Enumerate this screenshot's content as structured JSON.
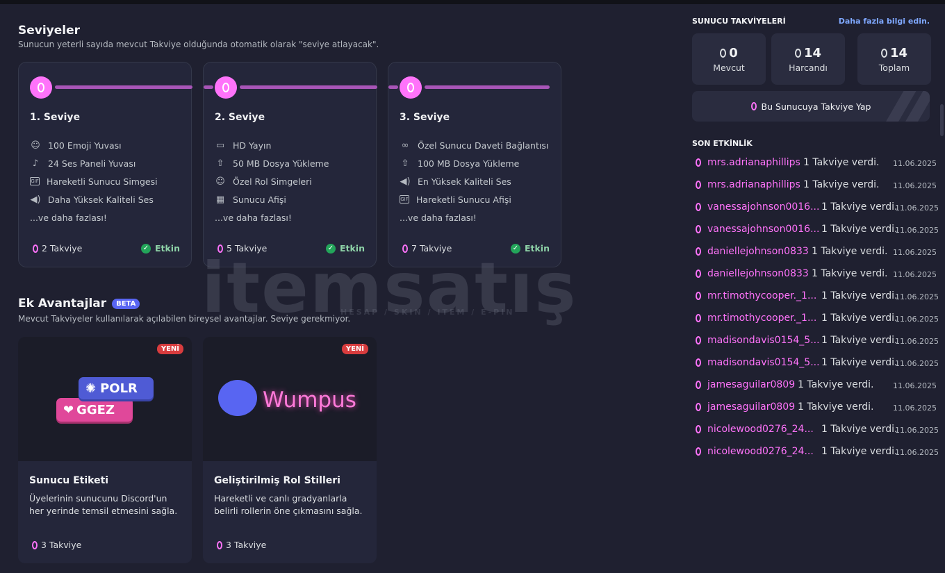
{
  "levels": {
    "title": "Seviyeler",
    "subtitle": "Sunucun yeterli sayıda mevcut Takviye olduğunda otomatik olarak \"seviye atlayacak\".",
    "tiers": [
      {
        "title": "1. Seviye",
        "perks": [
          "100 Emoji Yuvası",
          "24 Ses Paneli Yuvası",
          "Hareketli Sunucu Simgesi",
          "Daha Yüksek Kaliteli Ses"
        ],
        "more": "...ve daha fazlası!",
        "cost": "2 Takviye",
        "status": "Etkin"
      },
      {
        "title": "2. Seviye",
        "perks": [
          "HD Yayın",
          "50 MB Dosya Yükleme",
          "Özel Rol Simgeleri",
          "Sunucu Afişi"
        ],
        "more": "...ve daha fazlası!",
        "cost": "5 Takviye",
        "status": "Etkin"
      },
      {
        "title": "3. Seviye",
        "perks": [
          "Özel Sunucu Daveti Bağlantısı",
          "100 MB Dosya Yükleme",
          "En Yüksek Kaliteli Ses",
          "Hareketli Sunucu Afişi"
        ],
        "more": "...ve daha fazlası!",
        "cost": "7 Takviye",
        "status": "Etkin"
      }
    ],
    "perk_icons": [
      [
        "smile-icon",
        "speaker-board-icon",
        "gif-icon",
        "volume-icon"
      ],
      [
        "screen-share-icon",
        "upload-icon",
        "smile-icon",
        "grid-icon"
      ],
      [
        "link-icon",
        "upload-icon",
        "volume-icon",
        "gif-icon"
      ]
    ]
  },
  "extra": {
    "title": "Ek Avantajlar",
    "badge": "BETA",
    "subtitle": "Mevcut Takviyeler kullanılarak açılabilen bireysel avantajlar. Seviye gerekmiyor.",
    "cards": [
      {
        "badge": "YENİ",
        "title": "Sunucu Etiketi",
        "description": "Üyelerinin sunucunu Discord'un her yerinde temsil etmesini sağla.",
        "cost": "3 Takviye",
        "art_labels": [
          "POLR",
          "GGEZ"
        ]
      },
      {
        "badge": "YENİ",
        "title": "Geliştirilmiş Rol Stilleri",
        "description": "Hareketli ve canlı gradyanlarla belirli rollerin öne çıkmasını sağla.",
        "cost": "3 Takviye",
        "art_labels": [
          "Wumpus"
        ]
      }
    ]
  },
  "sidebar": {
    "title": "SUNUCU TAKVİYELERİ",
    "link": "Daha fazla bilgi edin.",
    "stats": [
      {
        "value": "0",
        "label": "Mevcut"
      },
      {
        "value": "14",
        "label": "Harcandı"
      },
      {
        "value": "14",
        "label": "Toplam"
      }
    ],
    "boost_button": "Bu Sunucuya Takviye Yap",
    "activity_title": "SON ETKİNLİK",
    "activity": [
      {
        "user": "mrs.adrianaphillips",
        "action": "1 Takviye verdi.",
        "date": "11.06.2025"
      },
      {
        "user": "mrs.adrianaphillips",
        "action": "1 Takviye verdi.",
        "date": "11.06.2025"
      },
      {
        "user": "vanessajohnson0016...",
        "action": "1 Takviye verdi.",
        "date": "11.06.2025"
      },
      {
        "user": "vanessajohnson0016...",
        "action": "1 Takviye verdi.",
        "date": "11.06.2025"
      },
      {
        "user": "daniellejohnson0833",
        "action": "1 Takviye verdi.",
        "date": "11.06.2025"
      },
      {
        "user": "daniellejohnson0833",
        "action": "1 Takviye verdi.",
        "date": "11.06.2025"
      },
      {
        "user": "mr.timothycooper._1...",
        "action": "1 Takviye verdi.",
        "date": "11.06.2025"
      },
      {
        "user": "mr.timothycooper._1...",
        "action": "1 Takviye verdi.",
        "date": "11.06.2025"
      },
      {
        "user": "madisondavis0154_5...",
        "action": "1 Takviye verdi.",
        "date": "11.06.2025"
      },
      {
        "user": "madisondavis0154_5...",
        "action": "1 Takviye verdi.",
        "date": "11.06.2025"
      },
      {
        "user": "jamesaguilar0809",
        "action": "1 Takviye verdi.",
        "date": "11.06.2025"
      },
      {
        "user": "jamesaguilar0809",
        "action": "1 Takviye verdi.",
        "date": "11.06.2025"
      },
      {
        "user": "nicolewood0276_24...",
        "action": "1 Takviye verdi.",
        "date": "11.06.2025"
      },
      {
        "user": "nicolewood0276_24...",
        "action": "1 Takviye verdi.",
        "date": "11.06.2025"
      }
    ]
  },
  "watermark": {
    "text": "itemsatış",
    "tagline": "HESAP / SKIN / ITEM / E-PIN"
  },
  "colors": {
    "accent_pink": "#ff73fa",
    "active_green": "#23a55a",
    "beta_blue": "#5865f2",
    "new_red": "#d83c3e"
  }
}
